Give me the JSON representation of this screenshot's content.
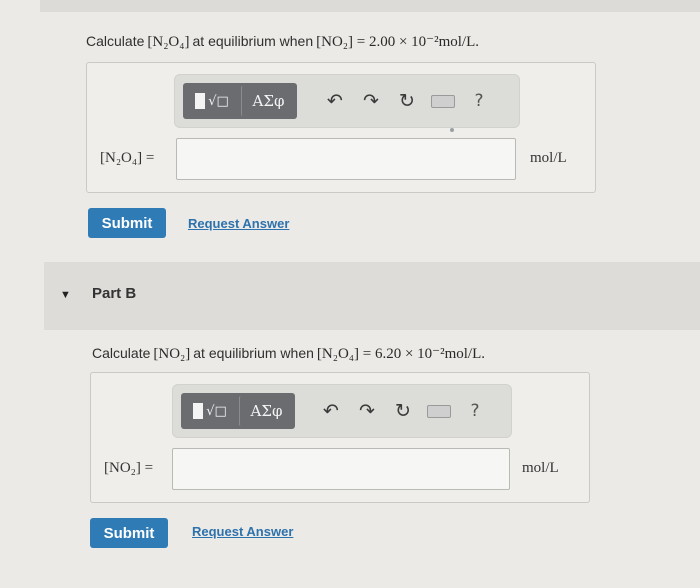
{
  "part_a": {
    "question": {
      "prefix": "Calculate",
      "target": "[N₂O₄]",
      "middle": "at equilibrium when",
      "given": "[NO₂] = 2.00 × 10⁻²mol/L."
    },
    "toolbar": {
      "templates_label": "√□",
      "symbols_label": "ΑΣφ",
      "undo": "↶",
      "redo": "↷",
      "reset": "↻",
      "help": "?"
    },
    "variable_label": "[N₂O₄] =",
    "input_value": "",
    "unit": "mol/L",
    "submit_label": "Submit",
    "request_answer_label": "Request Answer"
  },
  "part_b": {
    "title": "Part B",
    "question": {
      "prefix": "Calculate",
      "target": "[NO₂]",
      "middle": "at equilibrium when",
      "given": "[N₂O₄] = 6.20 × 10⁻²mol/L."
    },
    "toolbar": {
      "templates_label": "√□",
      "symbols_label": "ΑΣφ",
      "undo": "↶",
      "redo": "↷",
      "reset": "↻",
      "help": "?"
    },
    "variable_label": "[NO₂] =",
    "input_value": "",
    "unit": "mol/L",
    "submit_label": "Submit",
    "request_answer_label": "Request Answer"
  },
  "colors": {
    "submit": "#2f7bb5",
    "link": "#2d72ad",
    "toolbar_group": "#6a6c70"
  }
}
